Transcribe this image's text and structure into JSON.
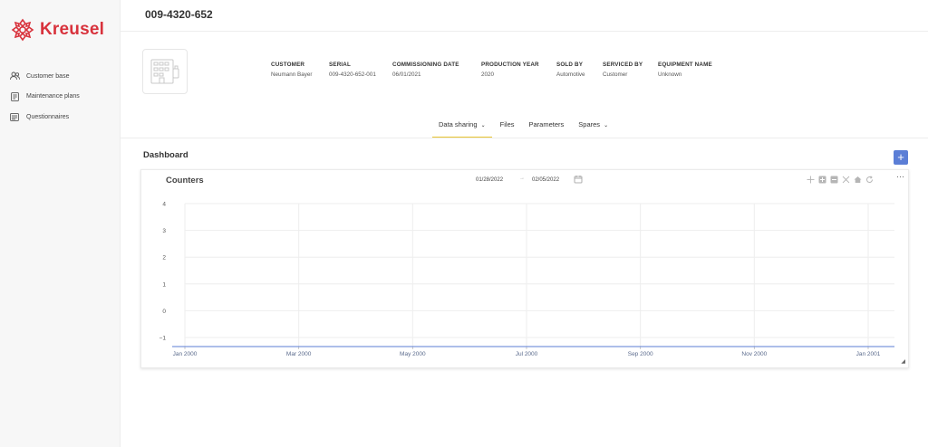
{
  "brand": {
    "name": "Kreusel",
    "color": "#d8323c"
  },
  "sidebar": {
    "items": [
      {
        "label": "Customer base",
        "icon": "users-icon"
      },
      {
        "label": "Maintenance plans",
        "icon": "document-icon"
      },
      {
        "label": "Questionnaires",
        "icon": "list-icon"
      }
    ]
  },
  "page": {
    "title": "009-4320-652"
  },
  "equipment": {
    "fields": [
      {
        "label": "CUSTOMER",
        "value": "Neumann Bayer"
      },
      {
        "label": "SERIAL",
        "value": "009-4320-652-001"
      },
      {
        "label": "COMMISSIONING DATE",
        "value": "06/01/2021"
      },
      {
        "label": "PRODUCTION YEAR",
        "value": "2020"
      },
      {
        "label": "SOLD BY",
        "value": "Automotive"
      },
      {
        "label": "SERVICED BY",
        "value": "Customer"
      },
      {
        "label": "EQUIPMENT NAME",
        "value": "Unknown"
      }
    ]
  },
  "tabs": [
    {
      "label": "Data sharing",
      "dropdown": true,
      "active": true
    },
    {
      "label": "Files",
      "dropdown": false,
      "active": false
    },
    {
      "label": "Parameters",
      "dropdown": false,
      "active": false
    },
    {
      "label": "Spares",
      "dropdown": true,
      "active": false
    }
  ],
  "dashboard": {
    "title": "Dashboard",
    "add_label": "+",
    "widget": {
      "title": "Counters",
      "date_from": "01/28/2022",
      "date_to": "02/05/2022",
      "date_separator": "→",
      "more_label": "···"
    }
  },
  "chart_data": {
    "type": "line",
    "title": "",
    "xlabel": "",
    "ylabel": "",
    "x_ticks": [
      "Jan 2000",
      "Mar 2000",
      "May 2000",
      "Jul 2000",
      "Sep 2000",
      "Nov 2000",
      "Jan 2001"
    ],
    "y_ticks": [
      "4",
      "3",
      "2",
      "1",
      "0",
      "−1"
    ],
    "ylim": [
      -1,
      4
    ],
    "series": [],
    "grid": true,
    "accent_color": "#5b7ed6"
  }
}
